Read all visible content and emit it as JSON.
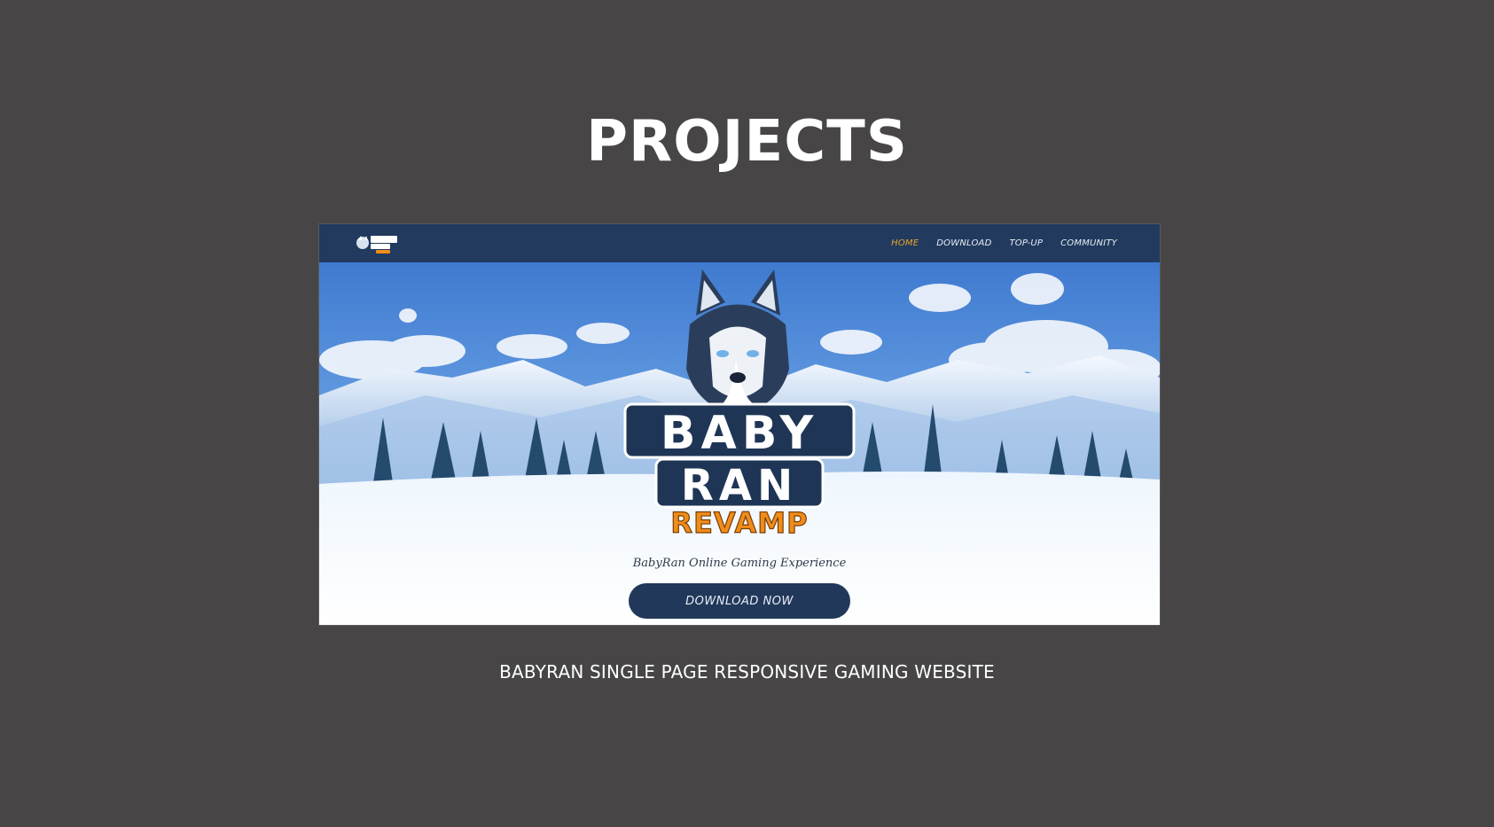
{
  "section": {
    "title": "PROJECTS"
  },
  "project": {
    "caption": "BABYRAN SINGLE PAGE RESPONSIVE GAMING WEBSITE",
    "preview": {
      "nav": {
        "logo_text": "BABY RAN",
        "links": [
          "HOME",
          "DOWNLOAD",
          "TOP-UP",
          "COMMUNITY"
        ],
        "active_index": 0
      },
      "hero": {
        "logo_line1": "BABY",
        "logo_line2": "RAN",
        "logo_line3": "REVAMP",
        "tagline": "BabyRan Online Gaming Experience",
        "cta_label": "DOWNLOAD NOW"
      }
    }
  },
  "colors": {
    "page_background": "#474546",
    "nav_background": "#223a5e",
    "active_link": "#e4a62e",
    "button_background": "#22385a",
    "revamp_orange": "#f08c1a"
  }
}
